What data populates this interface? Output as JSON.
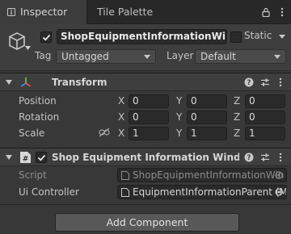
{
  "tabs": [
    {
      "label": "Inspector",
      "icon": "info-icon"
    },
    {
      "label": "Tile Palette"
    }
  ],
  "tab_actions": [
    "lock-icon",
    "kebab-menu-icon"
  ],
  "object": {
    "icon": "cube-icon",
    "active": true,
    "name": "ShopEquipmentInformationWindow",
    "static_label": "Static",
    "static_checked": false,
    "tag_label": "Tag",
    "tag_value": "Untagged",
    "layer_label": "Layer",
    "layer_value": "Default"
  },
  "transform": {
    "title": "Transform",
    "rows": [
      {
        "label": "Position",
        "x": "0",
        "y": "0",
        "z": "0"
      },
      {
        "label": "Rotation",
        "x": "0",
        "y": "0",
        "z": "0"
      },
      {
        "label": "Scale",
        "x": "1",
        "y": "1",
        "z": "1"
      }
    ],
    "axes": [
      "X",
      "Y",
      "Z"
    ]
  },
  "script_component": {
    "title": "Shop Equipment Information Window Co",
    "enabled": true,
    "script_label": "Script",
    "script_value": "ShopEquipmentInformationWin",
    "field_label": "Ui Controller",
    "field_value": "EquipmentInformationParent (M"
  },
  "add_component_label": "Add Component",
  "colors": {
    "background": "#383838",
    "header": "#3e3e3e",
    "field": "#2a2a2a",
    "button": "#585858"
  }
}
